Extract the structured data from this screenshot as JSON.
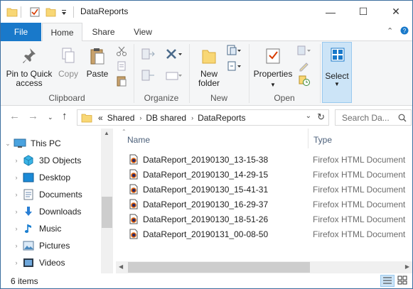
{
  "window": {
    "title": "DataReports",
    "controls": {
      "minimize": "—",
      "maximize": "☐",
      "close": "✕"
    }
  },
  "ribbon_tabs": {
    "file": "File",
    "home": "Home",
    "share": "Share",
    "view": "View",
    "active": "Home"
  },
  "ribbon": {
    "clipboard": {
      "pin_label": "Pin to Quick access",
      "copy_label": "Copy",
      "paste_label": "Paste",
      "group_label": "Clipboard"
    },
    "organize": {
      "group_label": "Organize"
    },
    "new": {
      "new_folder_label": "New folder",
      "group_label": "New"
    },
    "open": {
      "properties_label": "Properties",
      "group_label": "Open"
    },
    "select": {
      "select_label": "Select"
    }
  },
  "address": {
    "overflow": "«",
    "crumbs": [
      "Shared",
      "DB shared",
      "DataReports"
    ],
    "search_placeholder": "Search Da..."
  },
  "nav_tree": [
    {
      "label": "This PC",
      "icon": "this-pc-icon",
      "expanded": true
    },
    {
      "label": "3D Objects",
      "icon": "3d-objects-icon"
    },
    {
      "label": "Desktop",
      "icon": "desktop-icon"
    },
    {
      "label": "Documents",
      "icon": "documents-icon"
    },
    {
      "label": "Downloads",
      "icon": "downloads-icon"
    },
    {
      "label": "Music",
      "icon": "music-icon"
    },
    {
      "label": "Pictures",
      "icon": "pictures-icon"
    },
    {
      "label": "Videos",
      "icon": "videos-icon"
    }
  ],
  "columns": {
    "name": "Name",
    "type": "Type"
  },
  "files": [
    {
      "name": "DataReport_20190130_13-15-38",
      "type": "Firefox HTML Document"
    },
    {
      "name": "DataReport_20190130_14-29-15",
      "type": "Firefox HTML Document"
    },
    {
      "name": "DataReport_20190130_15-41-31",
      "type": "Firefox HTML Document"
    },
    {
      "name": "DataReport_20190130_16-29-37",
      "type": "Firefox HTML Document"
    },
    {
      "name": "DataReport_20190130_18-51-26",
      "type": "Firefox HTML Document"
    },
    {
      "name": "DataReport_20190131_00-08-50",
      "type": "Firefox HTML Document"
    }
  ],
  "status": {
    "item_count": "6 items"
  },
  "colors": {
    "accent": "#1979ca",
    "select_highlight": "#cce4f7",
    "folder": "#f8d775"
  }
}
